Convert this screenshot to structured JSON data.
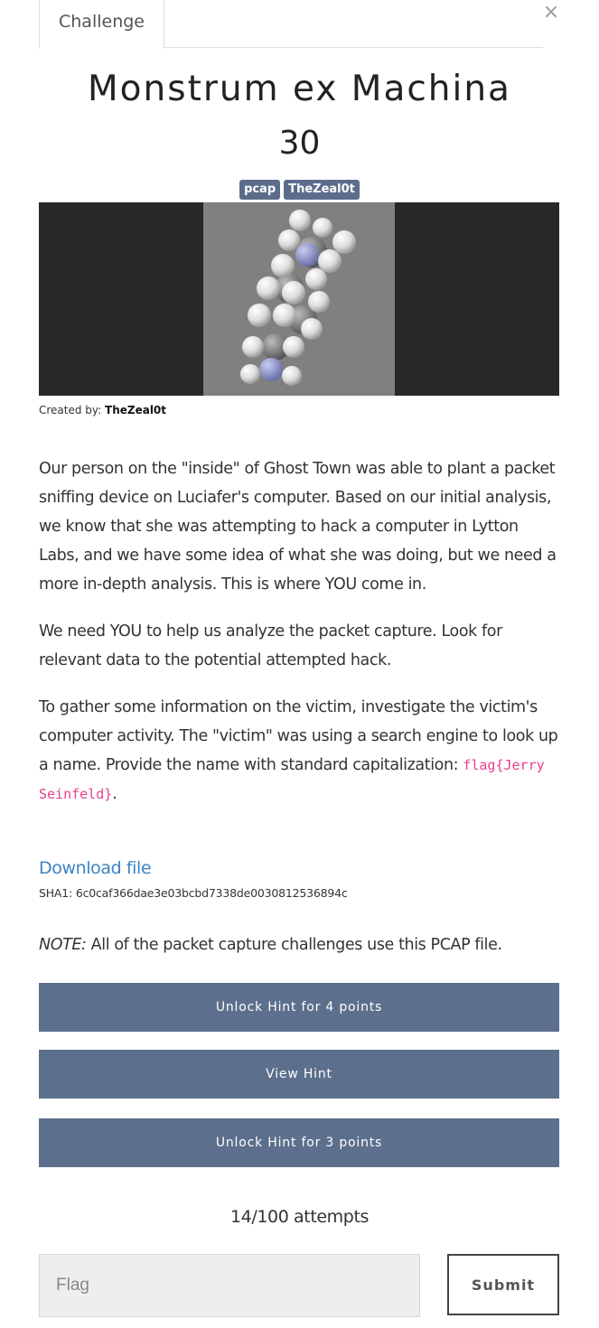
{
  "tabs": {
    "challenge_label": "Challenge"
  },
  "close_icon": "×",
  "challenge": {
    "name": "Monstrum ex Machina",
    "value": "30",
    "tags": [
      "pcap",
      "TheZeal0t"
    ],
    "created_by_label": "Created by: ",
    "created_by": "TheZeal0t"
  },
  "description": {
    "p1": "Our person on the \"inside\" of Ghost Town was able to plant a packet sniffing device on Luciafer's computer. Based on our initial analysis, we know that she was attempting to hack a computer in Lytton Labs, and we have some idea of what she was doing, but we need a more in-depth analysis. This is where YOU come in.",
    "p2": "We need YOU to help us analyze the packet capture. Look for relevant data to the potential attempted hack.",
    "p3_text": "To gather some information on the victim, investigate the victim's computer activity. The \"victim\" was using a search engine to look up a name. Provide the name with standard capitalization: ",
    "p3_code": "flag{Jerry Seinfeld}",
    "p3_end": "."
  },
  "download": {
    "label": "Download file",
    "sha": "SHA1: 6c0caf366dae3e03bcbd7338de0030812536894c"
  },
  "note": {
    "label": "NOTE:",
    "text": " All of the packet capture challenges use this PCAP file."
  },
  "hints": [
    "Unlock Hint for 4 points",
    "View Hint",
    "Unlock Hint for 3 points"
  ],
  "attempts": "14/100 attempts",
  "flag_input": {
    "placeholder": "Flag",
    "value": ""
  },
  "submit_label": "Submit",
  "colors": {
    "tag_bg": "#5b6d8b",
    "hint_button_bg": "#5c6f8c",
    "link": "#3a83c4",
    "code": "#e83e8c",
    "banner_bg": "#282828",
    "banner_inner": "#808080"
  }
}
